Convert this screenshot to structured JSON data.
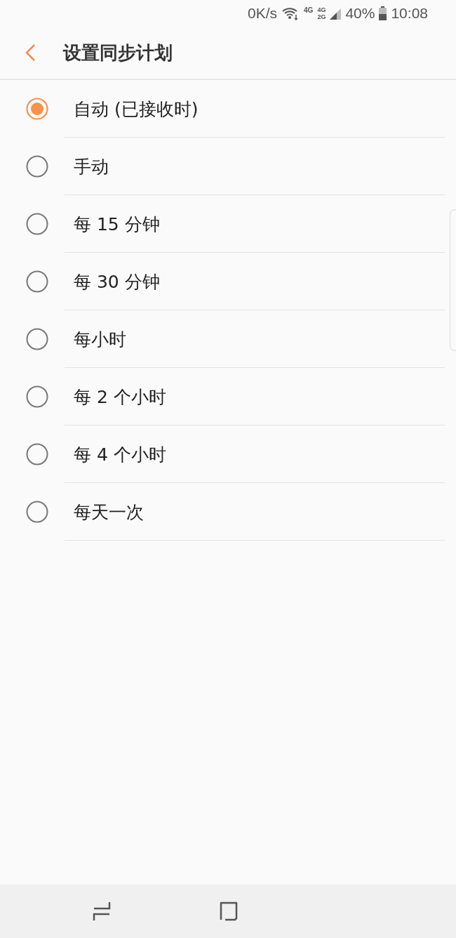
{
  "status_bar": {
    "speed": "0K/s",
    "network_1": "4G",
    "network_2_top": "4G",
    "network_2_bottom": "2G",
    "battery": "40%",
    "time": "10:08"
  },
  "header": {
    "title": "设置同步计划"
  },
  "options": [
    {
      "label": "自动 (已接收时)",
      "selected": true
    },
    {
      "label": "手动",
      "selected": false
    },
    {
      "label": "每 15 分钟",
      "selected": false
    },
    {
      "label": "每 30 分钟",
      "selected": false
    },
    {
      "label": "每小时",
      "selected": false
    },
    {
      "label": "每 2 个小时",
      "selected": false
    },
    {
      "label": "每 4 个小时",
      "selected": false
    },
    {
      "label": "每天一次",
      "selected": false
    }
  ]
}
